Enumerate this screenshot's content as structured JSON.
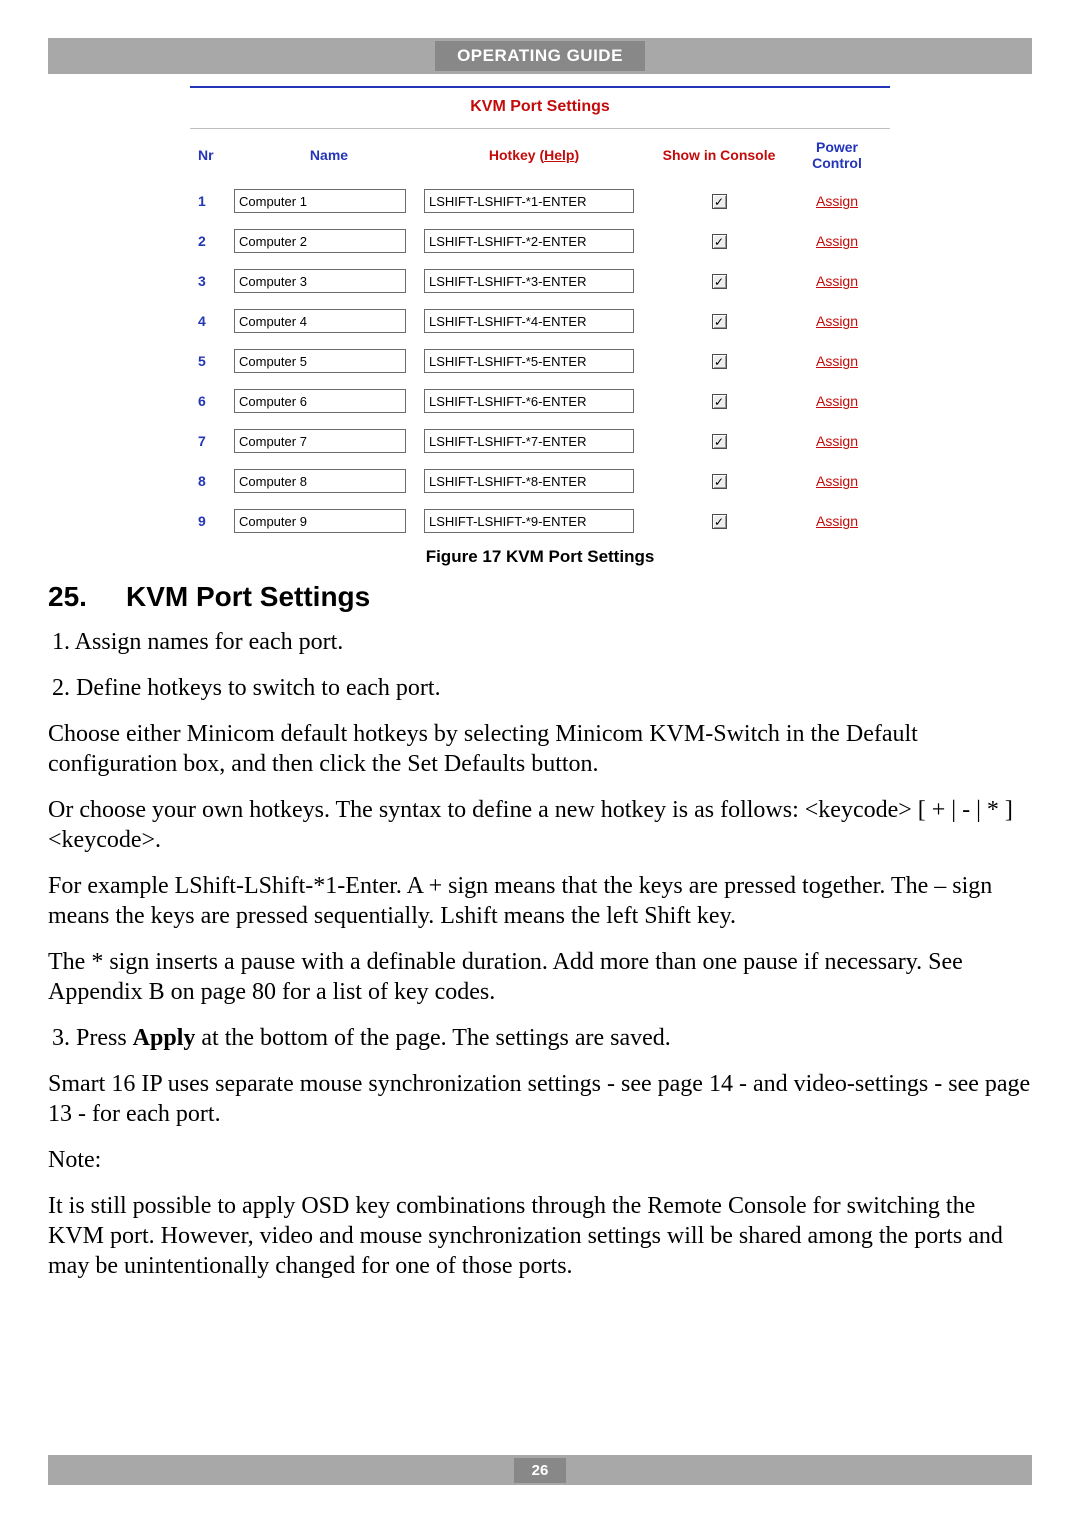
{
  "header": {
    "title": "OPERATING GUIDE"
  },
  "figure": {
    "title": "KVM Port Settings",
    "caption": "Figure 17 KVM Port Settings",
    "columns": {
      "nr": "Nr",
      "name": "Name",
      "hotkey_prefix": "Hotkey (",
      "hotkey_help": "Help",
      "hotkey_suffix": ")",
      "show": "Show in Console",
      "power": "Power Control"
    },
    "rows": [
      {
        "nr": "1",
        "name": "Computer 1",
        "hotkey": "LSHIFT-LSHIFT-*1-ENTER",
        "show": true,
        "assign": "Assign"
      },
      {
        "nr": "2",
        "name": "Computer 2",
        "hotkey": "LSHIFT-LSHIFT-*2-ENTER",
        "show": true,
        "assign": "Assign"
      },
      {
        "nr": "3",
        "name": "Computer 3",
        "hotkey": "LSHIFT-LSHIFT-*3-ENTER",
        "show": true,
        "assign": "Assign"
      },
      {
        "nr": "4",
        "name": "Computer 4",
        "hotkey": "LSHIFT-LSHIFT-*4-ENTER",
        "show": true,
        "assign": "Assign"
      },
      {
        "nr": "5",
        "name": "Computer 5",
        "hotkey": "LSHIFT-LSHIFT-*5-ENTER",
        "show": true,
        "assign": "Assign"
      },
      {
        "nr": "6",
        "name": "Computer 6",
        "hotkey": "LSHIFT-LSHIFT-*6-ENTER",
        "show": true,
        "assign": "Assign"
      },
      {
        "nr": "7",
        "name": "Computer 7",
        "hotkey": "LSHIFT-LSHIFT-*7-ENTER",
        "show": true,
        "assign": "Assign"
      },
      {
        "nr": "8",
        "name": "Computer 8",
        "hotkey": "LSHIFT-LSHIFT-*8-ENTER",
        "show": true,
        "assign": "Assign"
      },
      {
        "nr": "9",
        "name": "Computer 9",
        "hotkey": "LSHIFT-LSHIFT-*9-ENTER",
        "show": true,
        "assign": "Assign"
      }
    ]
  },
  "section": {
    "number": "25.",
    "title": "KVM Port Settings"
  },
  "body": {
    "li1": "1.  Assign names for each port.",
    "li2": "2.  Define hotkeys to switch to each port.",
    "p1": "Choose either Minicom default hotkeys by selecting Minicom KVM-Switch in the Default configuration box, and then click the Set Defaults button.",
    "p2": "Or choose your own hotkeys. The syntax to define a new hotkey is as follows: <keycode> [ + | - | * ] <keycode>.",
    "p3": "For example LShift-LShift-*1-Enter. A + sign means that the keys are pressed together. The – sign means the keys are pressed sequentially. Lshift means the left Shift key.",
    "p4": "The * sign inserts a pause with a definable duration. Add more than one pause if necessary. See Appendix B on page 80 for a list of key codes.",
    "li3_prefix": "3.  Press ",
    "li3_bold": "Apply",
    "li3_suffix": " at the bottom of the page. The settings are saved.",
    "p5": "Smart 16 IP uses separate mouse synchronization settings - see page 14 - and video-settings - see page 13 - for each port.",
    "p6": "Note:",
    "p7": "It is still possible to apply OSD key combinations through the Remote Console for switching the KVM port. However, video and mouse synchronization settings will be shared among the ports and may be unintentionally changed for one of those ports."
  },
  "footer": {
    "page": "26"
  }
}
